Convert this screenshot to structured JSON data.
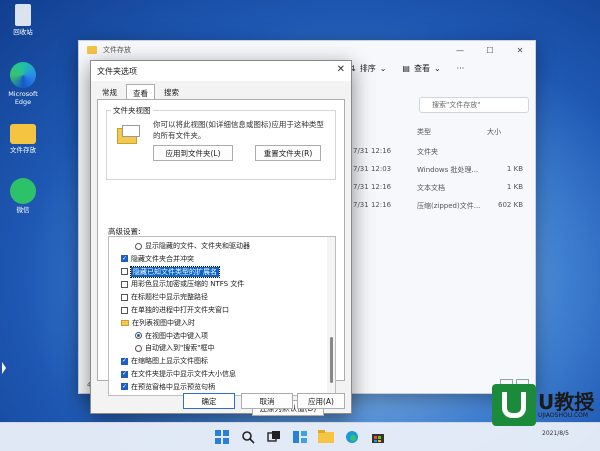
{
  "desktop": {
    "icons": [
      {
        "label": "回收站",
        "icon": "recycle-bin-icon"
      },
      {
        "label": "Microsoft Edge",
        "icon": "edge-icon"
      },
      {
        "label": "文件存放",
        "icon": "folder-icon"
      },
      {
        "label": "微信",
        "icon": "wechat-icon"
      }
    ]
  },
  "explorer": {
    "title": "文件存放",
    "controls": {
      "minimize": "—",
      "maximize": "☐",
      "close": "✕"
    },
    "toolbar": {
      "sort": "排序",
      "view": "查看",
      "more": "···"
    },
    "search_placeholder": "搜索\"文件存放\"",
    "columns": {
      "type": "类型",
      "size": "大小"
    },
    "rows": [
      {
        "date": "7/31 12:16",
        "type": "文件夹",
        "size": ""
      },
      {
        "date": "7/31 12:03",
        "type": "Windows 批处理...",
        "size": "1 KB"
      },
      {
        "date": "7/31 12:16",
        "type": "文本文档",
        "size": "1 KB"
      },
      {
        "date": "7/31 12:16",
        "type": "压缩(zipped)文件...",
        "size": "602 KB"
      }
    ],
    "status": "4"
  },
  "dialog": {
    "title": "文件夹选项",
    "close": "✕",
    "tabs": [
      "常规",
      "查看",
      "搜索"
    ],
    "active_tab": "查看",
    "folder_view": {
      "group_label": "文件夹视图",
      "description": "你可以将此视图(如详细信息或图标)应用于这种类型的所有文件夹。",
      "apply_button": "应用到文件夹(L)",
      "reset_button": "重置文件夹(R)"
    },
    "advanced_label": "高级设置:",
    "advanced_items": [
      {
        "kind": "radio",
        "checked": false,
        "indent": 2,
        "text": "显示隐藏的文件、文件夹和驱动器"
      },
      {
        "kind": "checkbox",
        "checked": true,
        "indent": 1,
        "text": "隐藏文件夹合并冲突"
      },
      {
        "kind": "checkbox",
        "checked": false,
        "indent": 1,
        "text": "隐藏已知文件类型的扩展名",
        "selected": true
      },
      {
        "kind": "checkbox",
        "checked": false,
        "indent": 1,
        "text": "用彩色显示加密或压缩的 NTFS 文件"
      },
      {
        "kind": "checkbox",
        "checked": false,
        "indent": 1,
        "text": "在标题栏中显示完整路径"
      },
      {
        "kind": "checkbox",
        "checked": false,
        "indent": 1,
        "text": "在单独的进程中打开文件夹窗口"
      },
      {
        "kind": "folder",
        "checked": false,
        "indent": 1,
        "text": "在列表视图中键入时"
      },
      {
        "kind": "radio",
        "checked": true,
        "indent": 2,
        "text": "在视图中选中键入项"
      },
      {
        "kind": "radio",
        "checked": false,
        "indent": 2,
        "text": "自动键入到\"搜索\"框中"
      },
      {
        "kind": "checkbox",
        "checked": true,
        "indent": 1,
        "text": "在缩略图上显示文件图标"
      },
      {
        "kind": "checkbox",
        "checked": true,
        "indent": 1,
        "text": "在文件夹提示中显示文件大小信息"
      },
      {
        "kind": "checkbox",
        "checked": true,
        "indent": 1,
        "text": "在预览窗格中显示预览句柄"
      }
    ],
    "restore_defaults": "还原为默认值(D)",
    "ok": "确定",
    "cancel": "取消",
    "apply": "应用(A)"
  },
  "taskbar": {
    "icons": [
      "start-icon",
      "search-icon",
      "task-view-icon",
      "widgets-icon",
      "file-explorer-icon",
      "edge-icon",
      "store-icon"
    ]
  },
  "watermark": {
    "brand": "U教授",
    "url": "UJIAOSHOU.COM",
    "date": "2021/8/5"
  }
}
